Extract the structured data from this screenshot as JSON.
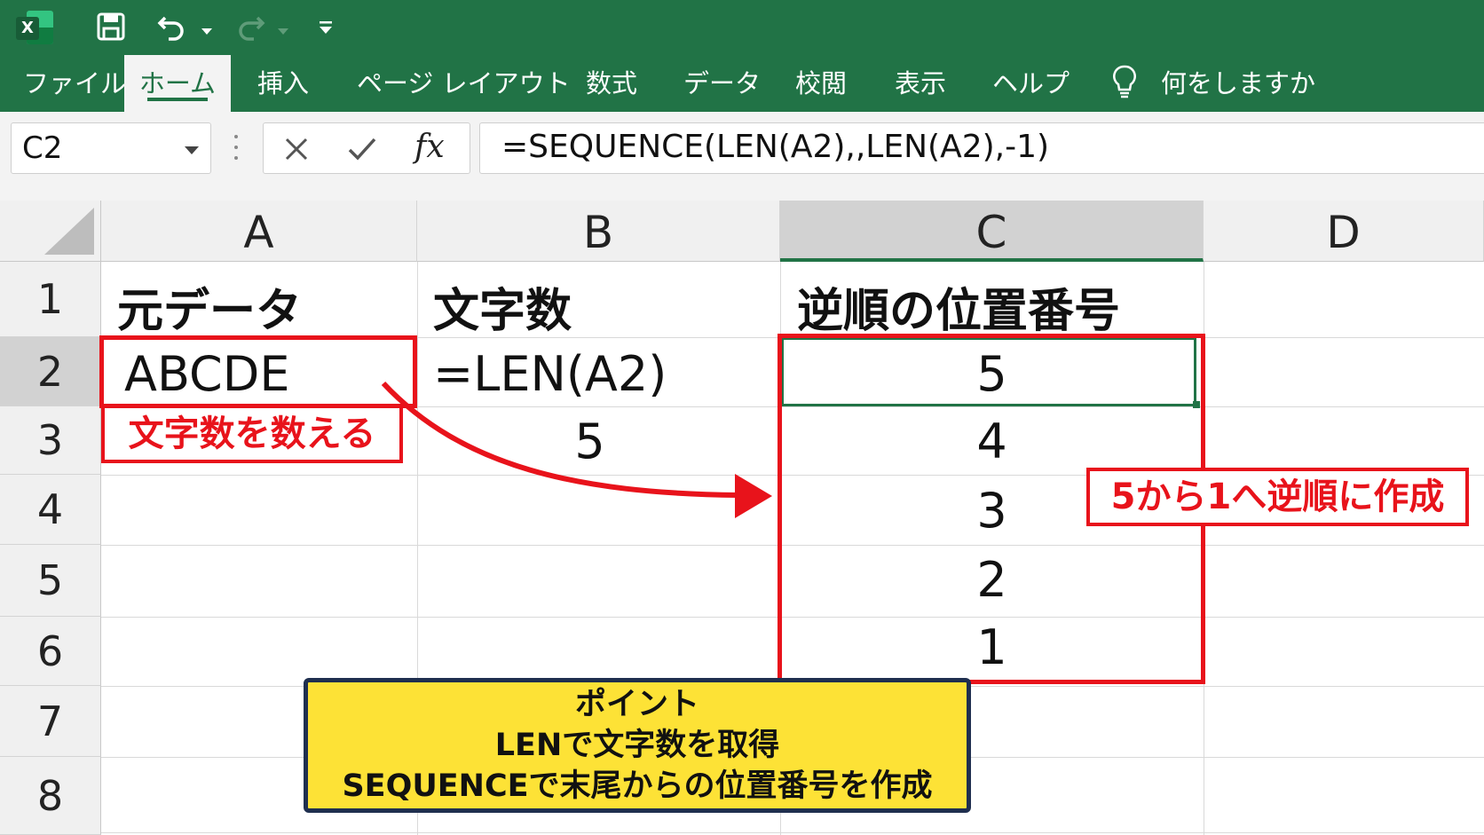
{
  "titlebar": {
    "app_icon": "excel-logo-icon",
    "app_letter": "X",
    "icons": [
      "save-icon",
      "undo-icon",
      "redo-icon",
      "customize-qat-icon"
    ]
  },
  "ribbon": {
    "tabs": [
      {
        "label": "ファイル"
      },
      {
        "label": "ホーム",
        "active": true
      },
      {
        "label": "挿入"
      },
      {
        "label": "ページ レイアウト"
      },
      {
        "label": "数式"
      },
      {
        "label": "データ"
      },
      {
        "label": "校閲"
      },
      {
        "label": "表示"
      },
      {
        "label": "ヘルプ"
      }
    ],
    "tell_me": "何をしますか",
    "tell_me_icon": "lightbulb-icon"
  },
  "formula_bar": {
    "name_box": "C2",
    "fx": "fx",
    "formula": "=SEQUENCE(LEN(A2),,LEN(A2),-1)"
  },
  "grid": {
    "columns": [
      "A",
      "B",
      "C",
      "D"
    ],
    "rows": [
      "1",
      "2",
      "3",
      "4",
      "5",
      "6",
      "7",
      "8"
    ],
    "selected_column": "C",
    "selected_row": "2",
    "cells": {
      "A1": "元データ",
      "B1": "文字数",
      "C1": "逆順の位置番号",
      "A2": "ABCDE",
      "B2": "=LEN(A2)",
      "B3": "5",
      "C2": "5",
      "C3": "4",
      "C4": "3",
      "C5": "2",
      "C6": "1"
    }
  },
  "annotations": {
    "count_label": "文字数を数える",
    "reverse_label": "5から1へ逆順に作成",
    "point": {
      "title": "ポイント",
      "line1": "LENで文字数を取得",
      "line2": "SEQUENCEで末尾からの位置番号を作成"
    },
    "colors": {
      "red": "#e8131b",
      "excel_green": "#217346",
      "note_yellow": "#fde236",
      "note_border": "#1f2f4f"
    }
  }
}
